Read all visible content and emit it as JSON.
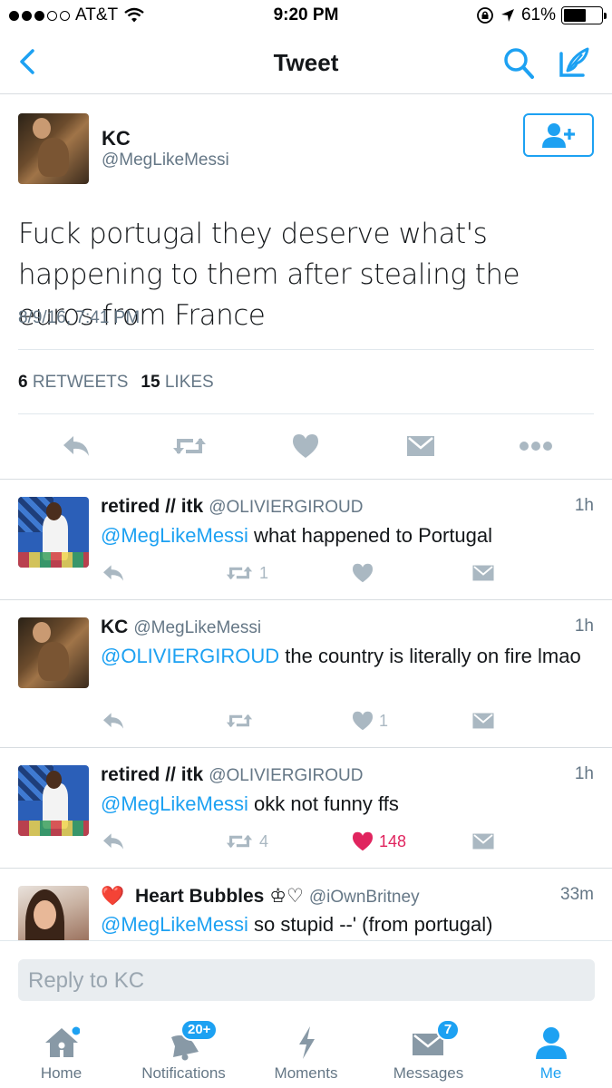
{
  "status_bar": {
    "carrier": "AT&T",
    "time": "9:20 PM",
    "battery": "61%",
    "battery_level": 0.61,
    "icons": [
      "signal-dots-icon",
      "wifi-icon",
      "rotation-lock-icon",
      "location-arrow-icon",
      "battery-icon"
    ]
  },
  "nav": {
    "title": "Tweet",
    "icons": [
      "back-chevron-icon",
      "search-icon",
      "compose-icon"
    ]
  },
  "main_tweet": {
    "name": "KC",
    "handle": "@MegLikeMessi",
    "text": "Fuck portugal they deserve what's happening to them after stealing the euros from France",
    "timestamp": "8/9/16, 7:41 PM",
    "retweets_count": "6",
    "retweets_label": "RETWEETS",
    "likes_count": "15",
    "likes_label": "LIKES",
    "follow_icon": "add-user-icon",
    "actions": [
      "reply-icon",
      "retweet-icon",
      "like-icon",
      "message-icon",
      "more-icon"
    ]
  },
  "replies": [
    {
      "name": "retired // itk",
      "handle": "@OLIVIERGIROUD",
      "time": "1h",
      "mention": "@MegLikeMessi",
      "text": " what happened to Portugal",
      "retweets": "1",
      "likes": "",
      "liked": false
    },
    {
      "name": "KC",
      "handle": "@MegLikeMessi",
      "time": "1h",
      "mention": "@OLIVIERGIROUD",
      "text": " the country is literally on fire lmao",
      "retweets": "",
      "likes": "1",
      "liked": false
    },
    {
      "name": "retired // itk",
      "handle": "@OLIVIERGIROUD",
      "time": "1h",
      "mention": "@MegLikeMessi",
      "text": " okk not funny ffs",
      "retweets": "4",
      "likes": "148",
      "liked": true
    },
    {
      "name_prefix": "❤️",
      "name": "Heart Bubbles ♔♡",
      "handle": "@iOwnBritney",
      "time": "33m",
      "mention": "@MegLikeMessi",
      "text": " so stupid --' (from portugal)"
    }
  ],
  "reply_bar": {
    "placeholder": "Reply to KC"
  },
  "tab_bar": {
    "tabs": [
      {
        "label": "Home",
        "icon": "home-icon"
      },
      {
        "label": "Notifications",
        "icon": "bell-icon",
        "badge": "20+"
      },
      {
        "label": "Moments",
        "icon": "lightning-icon"
      },
      {
        "label": "Messages",
        "icon": "envelope-icon",
        "badge": "7"
      },
      {
        "label": "Me",
        "icon": "person-icon",
        "active": true
      }
    ]
  },
  "colors": {
    "accent": "#1da1f2",
    "like": "#e0245e",
    "muted": "#657786",
    "icon_gray": "#aab8c2"
  }
}
